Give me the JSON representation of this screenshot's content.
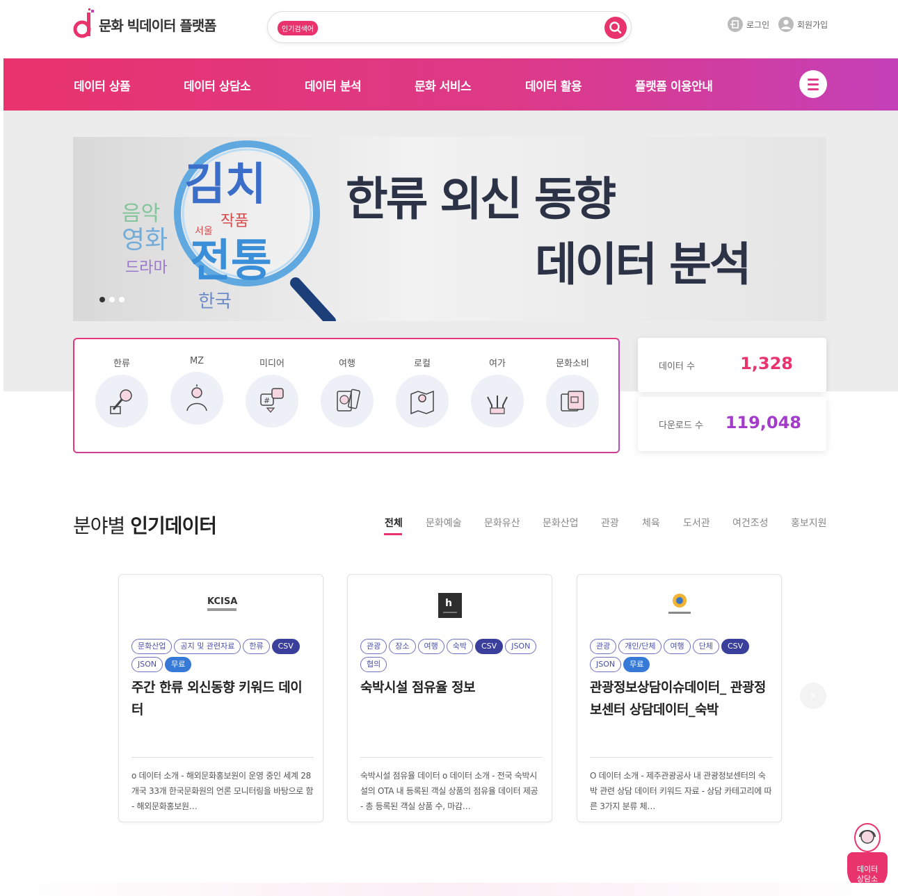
{
  "header": {
    "logo_text": "문화 빅데이터 플랫폼",
    "search_tag": "인기검색어",
    "search_placeholder": "",
    "login_label": "로그인",
    "signup_label": "회원가입"
  },
  "nav": {
    "items": [
      "데이터 상품",
      "데이터 상담소",
      "데이터 분석",
      "문화 서비스",
      "데이터 활용",
      "플랫폼 이용안내"
    ]
  },
  "banner": {
    "title_line1": "한류 외신 동향",
    "title_line2": "데이터 분석",
    "word_cloud": [
      "김치",
      "작품",
      "전통",
      "영화",
      "드라마",
      "음악",
      "서울",
      "한국"
    ]
  },
  "categories": [
    "한류",
    "MZ",
    "미디어",
    "여행",
    "로컬",
    "여가",
    "문화소비"
  ],
  "stats": {
    "data_count_label": "데이터 수",
    "data_count_value": "1,328",
    "download_label": "다운로드 수",
    "download_value": "119,048"
  },
  "popular": {
    "title_light": "분야별",
    "title_bold": "인기데이터",
    "tabs": [
      "전체",
      "문화예술",
      "문화유산",
      "문화산업",
      "관광",
      "체육",
      "도서관",
      "여건조성",
      "홍보지원"
    ]
  },
  "cards": [
    {
      "org": "KCISA 한국문화정보원",
      "tags": [
        "문화산업",
        "공지 및 관련자료",
        "한류",
        "CSV",
        "JSON",
        "무료"
      ],
      "title": "주간 한류 외신동향 키워드 데이터",
      "desc": "o 데이터 소개 - 해외문화홍보원이 운영 중인 세계 28개국 33개 한국문화원의 언론 모니터링을 바탕으로 함 - 해외문화홍보원…"
    },
    {
      "org": "",
      "tags": [
        "관광",
        "장소",
        "여행",
        "숙박",
        "CSV",
        "JSON",
        "협의"
      ],
      "title": "숙박시설 점유율 정보",
      "desc": "숙박시설 점유율 데이터 o 데이터 소개 - 전국 숙박시설의 OTA 내 등록된 객실 상품의 점유율 데이터 제공 - 총 등록된 객실 상품 수, 마감…"
    },
    {
      "org": "제주관광공사",
      "tags": [
        "관광",
        "개인/단체",
        "여행",
        "단체",
        "CSV",
        "JSON",
        "무료"
      ],
      "title": "관광정보상담이슈데이터_ 관광정보센터 상담데이터_숙박",
      "desc": "O 데이터 소개 - 제주관광공사 내 관광정보센터의 숙박 관련 상담 데이터 키워드 자료 - 상담 카테고리에 따른 3가지 분류 체…"
    }
  ],
  "floating_button": {
    "line1": "데이터",
    "line2": "상담소"
  },
  "colors": {
    "accent": "#e8336d",
    "purple": "#c440b8",
    "tag_blue": "#3b3f9c"
  }
}
